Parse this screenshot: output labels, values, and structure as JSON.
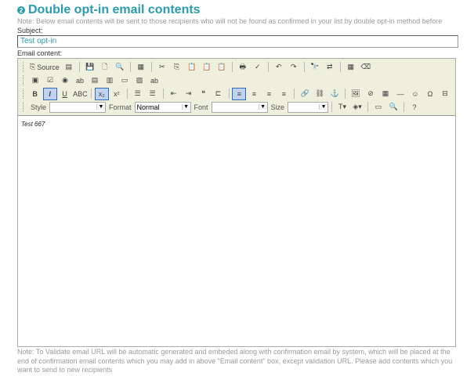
{
  "title": {
    "number": "2",
    "text": "Double opt-in email contents"
  },
  "note_top": "Note: Below email contents will be sent to those recipients who will not be found as confirmed in your list by double opt-in method before",
  "subject": {
    "label": "Subject:",
    "value": "Test opt-in"
  },
  "email_content": {
    "label": "Email content:",
    "body": "Test 667"
  },
  "toolbar": {
    "rows": [
      [
        {
          "n": "source",
          "g": "⎘",
          "t": "Source"
        },
        {
          "n": "preview-template",
          "g": "▤"
        },
        "|",
        {
          "n": "save",
          "g": "💾"
        },
        {
          "n": "new-page",
          "g": "🗋"
        },
        {
          "n": "preview",
          "g": "🔍"
        },
        "|",
        {
          "n": "templates",
          "g": "▦"
        },
        "|",
        {
          "n": "cut",
          "g": "✂"
        },
        {
          "n": "copy",
          "g": "⎘"
        },
        {
          "n": "paste",
          "g": "📋"
        },
        {
          "n": "paste-text",
          "g": "📋"
        },
        {
          "n": "paste-word",
          "g": "📋"
        },
        "|",
        {
          "n": "print",
          "g": "🖶"
        },
        {
          "n": "spellcheck",
          "g": "✓"
        },
        "|",
        {
          "n": "undo",
          "g": "↶"
        },
        {
          "n": "redo",
          "g": "↷"
        },
        "|",
        {
          "n": "find",
          "g": "🔭"
        },
        {
          "n": "replace",
          "g": "⇄"
        },
        "|",
        {
          "n": "select-all",
          "g": "▦"
        },
        {
          "n": "remove-format",
          "g": "⌫"
        }
      ],
      [
        {
          "n": "form",
          "g": "▣"
        },
        {
          "n": "checkbox",
          "g": "☑"
        },
        {
          "n": "radio",
          "g": "◉"
        },
        {
          "n": "text-field",
          "g": "ab"
        },
        {
          "n": "textarea",
          "g": "▤"
        },
        {
          "n": "select-field",
          "g": "▥"
        },
        {
          "n": "button",
          "g": "▭"
        },
        {
          "n": "image-button",
          "g": "▨"
        },
        {
          "n": "hidden-field",
          "g": "ab"
        }
      ],
      [
        {
          "n": "bold",
          "g": "B"
        },
        {
          "n": "italic",
          "g": "I",
          "on": true
        },
        {
          "n": "underline",
          "g": "U"
        },
        {
          "n": "strike",
          "g": "ABC"
        },
        "|",
        {
          "n": "subscript",
          "g": "x₂",
          "on": true
        },
        {
          "n": "superscript",
          "g": "x²"
        },
        "|",
        {
          "n": "ordered-list",
          "g": "☰"
        },
        {
          "n": "bullet-list",
          "g": "☰"
        },
        "|",
        {
          "n": "outdent",
          "g": "⇤"
        },
        {
          "n": "indent",
          "g": "⇥"
        },
        {
          "n": "blockquote",
          "g": "❝"
        },
        {
          "n": "div",
          "g": "⊏"
        },
        "|",
        {
          "n": "align-left",
          "g": "≡",
          "on": true
        },
        {
          "n": "align-center",
          "g": "≡"
        },
        {
          "n": "align-right",
          "g": "≡"
        },
        {
          "n": "justify",
          "g": "≡"
        },
        "|",
        {
          "n": "link",
          "g": "🔗"
        },
        {
          "n": "unlink",
          "g": "⛓"
        },
        {
          "n": "anchor",
          "g": "⚓"
        },
        "|",
        {
          "n": "image",
          "g": "🖼"
        },
        {
          "n": "flash",
          "g": "⊘"
        },
        {
          "n": "table",
          "g": "▦"
        },
        {
          "n": "horizontal-rule",
          "g": "―"
        },
        {
          "n": "smiley",
          "g": "☺"
        },
        {
          "n": "special-char",
          "g": "Ω"
        },
        {
          "n": "page-break",
          "g": "⊟"
        }
      ]
    ],
    "combos": [
      {
        "label": "Style",
        "value": ""
      },
      {
        "label": "Format",
        "value": "Normal"
      },
      {
        "label": "Font",
        "value": ""
      },
      {
        "label": "Size",
        "value": ""
      }
    ],
    "row4_tail": [
      {
        "n": "text-color",
        "g": "T▾"
      },
      {
        "n": "bg-color",
        "g": "◈▾"
      },
      "|",
      {
        "n": "maximize",
        "g": "▭"
      },
      {
        "n": "show-blocks",
        "g": "🔍"
      },
      "|",
      {
        "n": "about",
        "g": "?"
      }
    ]
  },
  "note_bottom": "Note: To Validate email URL will be automatic generated and embeded along with confirmation email by system, which will be placed at the end of confirmation email contents which you may add in above \"Email content\" box, except validation URL. Please add contents which you want to send to new recipients"
}
